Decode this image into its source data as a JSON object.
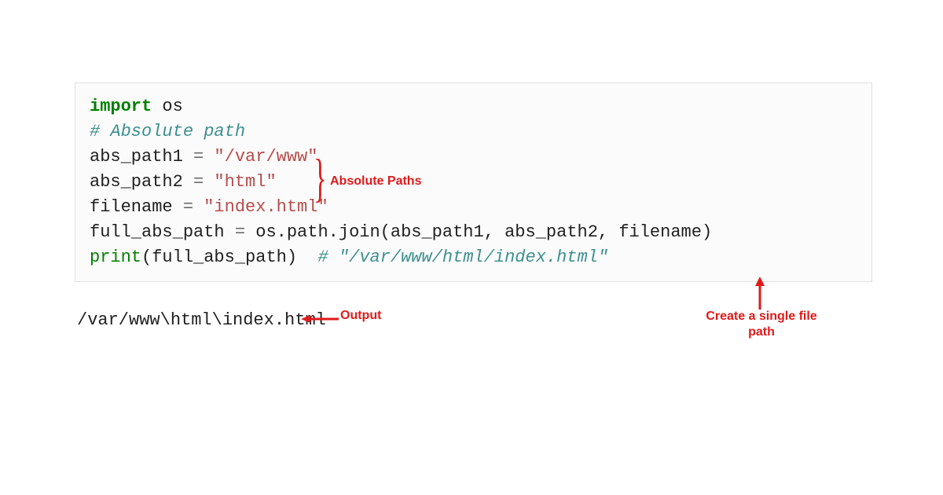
{
  "code": {
    "line1_kw": "import",
    "line1_mod": " os",
    "blank1": "",
    "line2_comment": "# Absolute path",
    "line3_var": "abs_path1 ",
    "line3_op": "=",
    "line3_str": " \"/var/www\"",
    "line4_var": "abs_path2 ",
    "line4_op": "=",
    "line4_str": " \"html\"",
    "line5_var": "filename ",
    "line5_op": "=",
    "line5_str": " \"index.html\"",
    "line6_var": "full_abs_path ",
    "line6_op": "=",
    "line6_rest": " os.path.join(abs_path1, abs_path2, filename)",
    "line7_print": "print",
    "line7_args": "(full_abs_path)  ",
    "line7_comment": "# \"/var/www/html/index.html\""
  },
  "output": "/var/www\\html\\index.html",
  "annotations": {
    "abs_paths": "Absolute Paths",
    "output": "Output",
    "single_path": "Create a single file path"
  },
  "brace": "}"
}
